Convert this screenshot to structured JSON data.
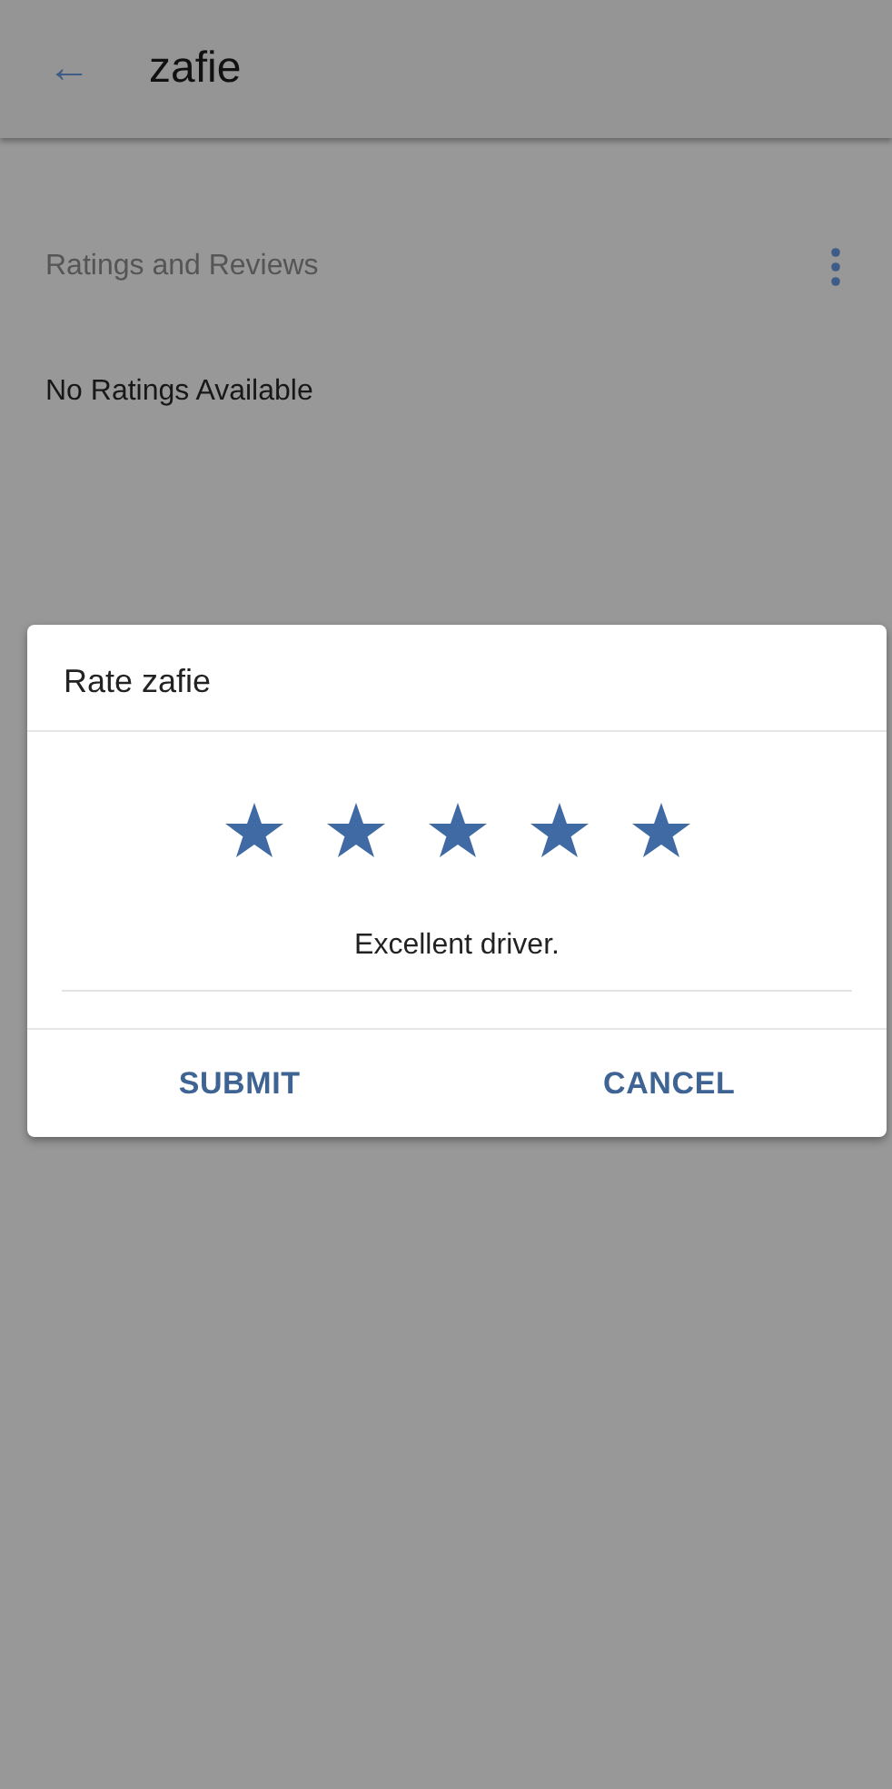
{
  "app_bar": {
    "back_icon": "←",
    "title": "zafie"
  },
  "section": {
    "heading": "Ratings and Reviews",
    "empty_text": "No Ratings Available"
  },
  "dialog": {
    "title": "Rate zafie",
    "stars": 5,
    "comment": "Excellent driver.",
    "buttons": [
      "SUBMIT",
      "CANCEL"
    ]
  }
}
